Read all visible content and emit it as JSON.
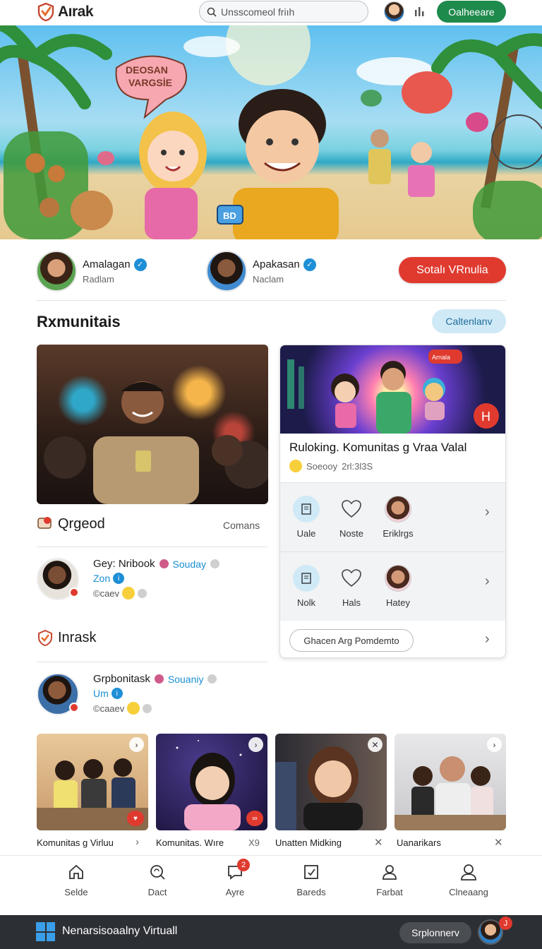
{
  "header": {
    "app_name": "Aırak",
    "search_placeholder": "Unsscomeol friıh",
    "cta_label": "Oalheeare",
    "icon": "chart-icon"
  },
  "hero": {
    "speech_bubble": "DEOSAN\nVARGSİE",
    "badge_text": "BD"
  },
  "profiles": [
    {
      "name": "Amalagan",
      "sub": "Radlam"
    },
    {
      "name": "Apakasan",
      "sub": "Naclam"
    }
  ],
  "red_button": "Sotalı VRnulia",
  "community": {
    "title": "Rxmunitais",
    "pill_button": "Caltenlanv"
  },
  "left": {
    "section1_label": "Qrgeod",
    "section1_link": "Comans",
    "user1": {
      "name": "Gey: Nribook",
      "tag": "Souday",
      "line2": "Zon",
      "line3": "©caev"
    },
    "section2_label": "Inrask",
    "user2": {
      "name": "Grpbonitask",
      "tag": "Souaniy",
      "line2": "Um",
      "line3": "©caaev"
    }
  },
  "right_card": {
    "title": "Ruloking. Komunitas g Vraa Valal",
    "meta_name": "Soeooy",
    "meta_time": "2rl:3l3S",
    "bubble_text": "Arnala",
    "badge_letter": "H",
    "row1": [
      "Uale",
      "Noste",
      "Eriklrgs"
    ],
    "row2": [
      "Nolk",
      "Hals",
      "Hatey"
    ],
    "outline_button": "Ghacen Arg Pomdemto"
  },
  "thumbnails": [
    {
      "caption": "Komunitas g Virluu",
      "action": "›",
      "corner": "›"
    },
    {
      "caption": "Komunitas. Wıre",
      "action": "X9",
      "corner": "›"
    },
    {
      "caption": "Unatten Midking",
      "action": "✕",
      "corner": "✕"
    },
    {
      "caption": "Uanarikars",
      "action": "✕",
      "corner": "›"
    }
  ],
  "bottom_nav": [
    {
      "label": "Selde",
      "icon": "home-icon"
    },
    {
      "label": "Dact",
      "icon": "search-refresh-icon"
    },
    {
      "label": "Ayre",
      "icon": "chat-icon",
      "badge": "2"
    },
    {
      "label": "Bareds",
      "icon": "edit-box-icon"
    },
    {
      "label": "Farbat",
      "icon": "user-icon"
    },
    {
      "label": "Clneaang",
      "icon": "profile-icon"
    }
  ],
  "taskbar": {
    "title": "Nenarsisoaalny Virtuall",
    "button": "Srplonnerv",
    "badge": "J"
  },
  "colors": {
    "brand_green": "#1e8a4c",
    "accent_red": "#e03a2f",
    "accent_blue": "#1e8fd6",
    "pill_blue": "#cfe9f7",
    "taskbar": "#2c2f33"
  }
}
